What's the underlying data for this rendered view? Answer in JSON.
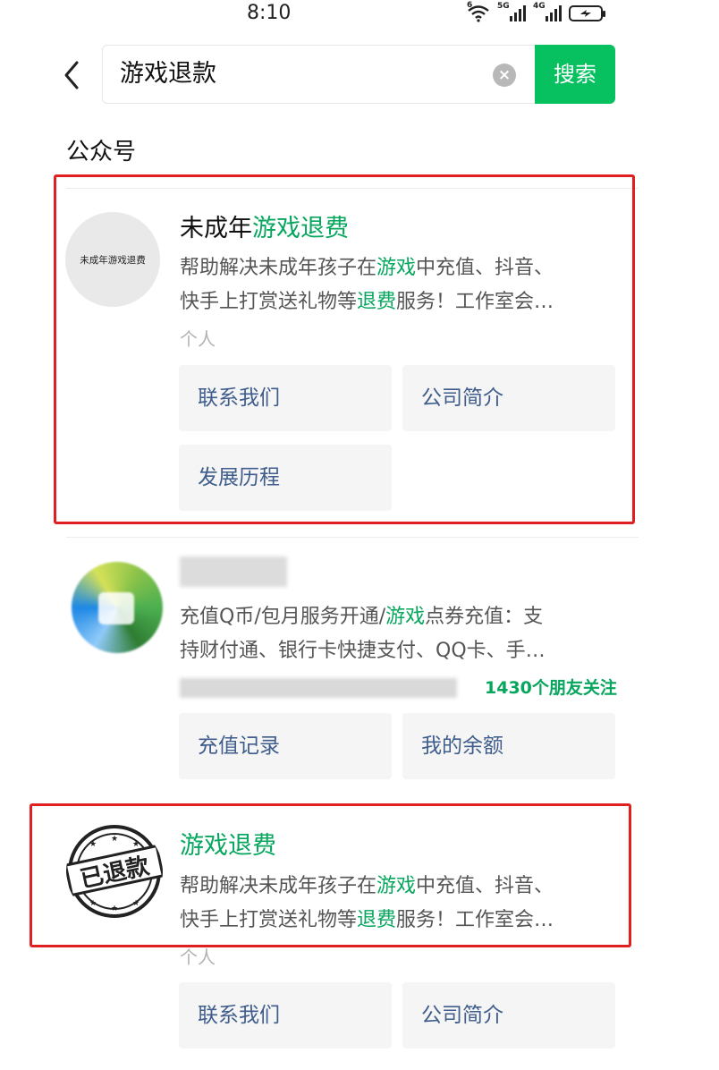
{
  "status_bar": {
    "time": "8:10",
    "wifi_label": "6",
    "sim1_label": "5G",
    "sim2_label": "4G"
  },
  "search": {
    "query": "游戏退款",
    "clear_symbol": "×",
    "button_label": "搜索",
    "back_icon": "chevron-left-icon"
  },
  "section": {
    "title": "公众号"
  },
  "results": [
    {
      "avatar_text": "未成年游戏退费",
      "name_plain": "未成年",
      "name_highlight": "游戏退费",
      "desc_line1_a": "帮助解决未成年孩子在",
      "desc_line1_hl": "游戏",
      "desc_line1_b": "中充值、抖音、",
      "desc_line2_a": "快手上打赏送礼物等",
      "desc_line2_hl": "退费",
      "desc_line2_b": "服务！工作室会…",
      "meta": "个人",
      "buttons": [
        "联系我们",
        "公司简介",
        "发展历程"
      ]
    },
    {
      "desc_line1_a": "充值Q币/包月服务开通/",
      "desc_line1_hl": "游戏",
      "desc_line1_b": "点券充值：支",
      "desc_line2": "持财付通、银行卡快捷支付、QQ卡、手…",
      "followers": "1430个朋友关注",
      "buttons": [
        "充值记录",
        "我的余额"
      ]
    },
    {
      "stamp_text": "已退款",
      "name_highlight": "游戏退费",
      "desc_line1_a": "帮助解决未成年孩子在",
      "desc_line1_hl": "游戏",
      "desc_line1_b": "中充值、抖音、",
      "desc_line2_a": "快手上打赏送礼物等",
      "desc_line2_hl": "退费",
      "desc_line2_b": "服务！工作室会…",
      "meta": "个人",
      "buttons": [
        "联系我们",
        "公司简介"
      ]
    }
  ],
  "colors": {
    "accent": "#07c160",
    "highlight": "#07a65e",
    "link_button_text": "#3f5d8c",
    "annotation_box": "#e02020"
  }
}
